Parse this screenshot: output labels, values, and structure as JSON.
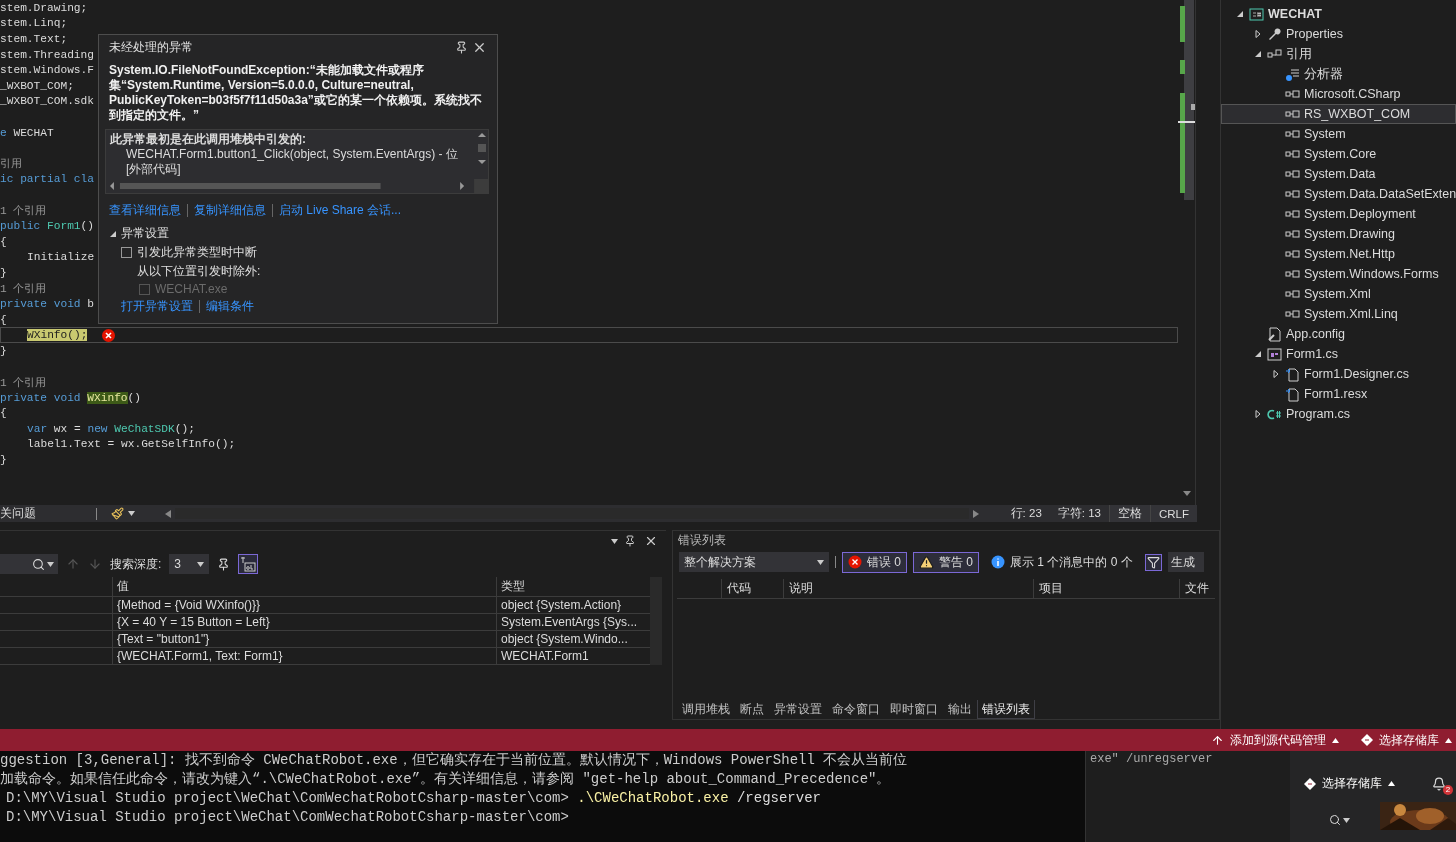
{
  "editor": {
    "code_lines": [
      {
        "kind": "code",
        "tokens": [
          {
            "text": "stem.Drawing;",
            "kind": "plain"
          }
        ]
      },
      {
        "kind": "code",
        "tokens": [
          {
            "text": "stem.Linq;",
            "kind": "plain"
          }
        ]
      },
      {
        "kind": "code",
        "tokens": [
          {
            "text": "stem.Text;",
            "kind": "plain"
          }
        ]
      },
      {
        "kind": "code",
        "tokens": [
          {
            "text": "stem.Threading",
            "kind": "plain"
          }
        ]
      },
      {
        "kind": "code",
        "tokens": [
          {
            "text": "stem.Windows.F",
            "kind": "plain"
          }
        ]
      },
      {
        "kind": "code",
        "tokens": [
          {
            "text": "_WXBOT_COM;",
            "kind": "plain"
          }
        ]
      },
      {
        "kind": "code",
        "tokens": [
          {
            "text": "_WXBOT_COM.sdk",
            "kind": "plain"
          }
        ]
      },
      {
        "kind": "blank"
      },
      {
        "kind": "code",
        "tokens": [
          {
            "text": "e",
            "kind": "keyword"
          },
          {
            "text": " WECHAT",
            "kind": "plain"
          }
        ]
      },
      {
        "kind": "blank"
      },
      {
        "kind": "lens",
        "text": "引用"
      },
      {
        "kind": "code",
        "tokens": [
          {
            "text": "ic partial cla",
            "kind": "keyword"
          }
        ]
      },
      {
        "kind": "blank"
      },
      {
        "kind": "lens",
        "text": "1 个引用"
      },
      {
        "kind": "code",
        "tokens": [
          {
            "text": "public ",
            "kind": "keyword"
          },
          {
            "text": "Form1",
            "kind": "type"
          },
          {
            "text": "()",
            "kind": "plain"
          }
        ]
      },
      {
        "kind": "code",
        "tokens": [
          {
            "text": "{",
            "kind": "plain"
          }
        ]
      },
      {
        "kind": "code",
        "indented": true,
        "tokens": [
          {
            "text": "Initialize",
            "kind": "plain"
          }
        ]
      },
      {
        "kind": "code",
        "tokens": [
          {
            "text": "}",
            "kind": "plain"
          }
        ]
      },
      {
        "kind": "lens",
        "text": "1 个引用"
      },
      {
        "kind": "code",
        "tokens": [
          {
            "text": "private void ",
            "kind": "keyword"
          },
          {
            "text": "b",
            "kind": "plain"
          }
        ]
      },
      {
        "kind": "code",
        "tokens": [
          {
            "text": "{",
            "kind": "plain"
          }
        ]
      },
      {
        "kind": "code",
        "indented": true,
        "current": true,
        "exception": true,
        "tokens": [
          {
            "text": "WXinfo();",
            "kind": "execution"
          }
        ]
      },
      {
        "kind": "code",
        "tokens": [
          {
            "text": "}",
            "kind": "plain"
          }
        ]
      },
      {
        "kind": "blank"
      },
      {
        "kind": "lens",
        "text": "1 个引用"
      },
      {
        "kind": "code",
        "tokens": [
          {
            "text": "private void ",
            "kind": "keyword"
          },
          {
            "text": "WXinfo",
            "kind": "reference"
          },
          {
            "text": "()",
            "kind": "plain"
          }
        ]
      },
      {
        "kind": "code",
        "tokens": [
          {
            "text": "{",
            "kind": "plain"
          }
        ]
      },
      {
        "kind": "code",
        "indented": true,
        "tokens": [
          {
            "text": "var ",
            "kind": "keyword"
          },
          {
            "text": "wx = ",
            "kind": "plain"
          },
          {
            "text": "new ",
            "kind": "keyword"
          },
          {
            "text": "WeChatSDK",
            "kind": "type"
          },
          {
            "text": "();",
            "kind": "plain"
          }
        ]
      },
      {
        "kind": "code",
        "indented": true,
        "tokens": [
          {
            "text": "label1.Text = wx.GetSelfInfo();",
            "kind": "plain"
          }
        ]
      },
      {
        "kind": "code",
        "tokens": [
          {
            "text": "}",
            "kind": "plain"
          }
        ]
      }
    ],
    "status": {
      "issues": "关问题",
      "line": "行: 23",
      "char": "字符: 13",
      "indent": "空格",
      "eol": "CRLF"
    }
  },
  "exception_popup": {
    "title": "未经处理的异常",
    "message": "System.IO.FileNotFoundException:“未能加载文件或程序集“System.Runtime, Version=5.0.0.0, Culture=neutral, PublicKeyToken=b03f5f7f11d50a3a”或它的某一个依赖项。系统找不到指定的文件。”",
    "stack_heading": "此异常最初是在此调用堆栈中引发的:",
    "stack_lines": [
      "WECHAT.Form1.button1_Click(object, System.EventArgs) - 位",
      "[外部代码]"
    ],
    "links": [
      "查看详细信息",
      "复制详细信息",
      "启动 Live Share 会话..."
    ],
    "settings": {
      "title": "异常设置",
      "expanded": true,
      "break_option": {
        "label": "引发此异常类型时中断",
        "checked": false,
        "disabled": false
      },
      "except_label": "从以下位置引发时除外:",
      "except_option": {
        "label": "WECHAT.exe",
        "checked": false,
        "disabled": true
      },
      "links": [
        "打开异常设置",
        "编辑条件"
      ]
    }
  },
  "locals_panel": {
    "search_depth_label": "搜索深度:",
    "search_depth": "3",
    "string_view_selected": true,
    "columns": [
      "值",
      "类型"
    ],
    "rows": [
      {
        "value": "{Method = {Void WXinfo()}}",
        "type": "object {System.Action}"
      },
      {
        "value": "{X = 40 Y = 15 Button = Left}",
        "type": "System.EventArgs {Sys..."
      },
      {
        "value": "{Text = \"button1\"}",
        "type": "object {System.Windo..."
      },
      {
        "value": "{WECHAT.Form1, Text: Form1}",
        "type": "WECHAT.Form1"
      }
    ]
  },
  "error_list": {
    "title": "错误列表",
    "scope": "整个解决方案",
    "filters": [
      {
        "kind": "error",
        "label": "错误 0",
        "selected": true
      },
      {
        "kind": "warning",
        "label": "警告 0",
        "selected": true
      },
      {
        "kind": "message",
        "label": "展示 1 个消息中的 0 个",
        "selected": false
      }
    ],
    "filter_toggle_selected": true,
    "build_source": "生成",
    "columns": [
      "代码",
      "说明",
      "项目",
      "文件"
    ]
  },
  "tool_tabs": [
    {
      "label": "调用堆栈",
      "selected": false
    },
    {
      "label": "断点",
      "selected": false
    },
    {
      "label": "异常设置",
      "selected": false
    },
    {
      "label": "命令窗口",
      "selected": false
    },
    {
      "label": "即时窗口",
      "selected": false
    },
    {
      "label": "输出",
      "selected": false
    },
    {
      "label": "错误列表",
      "selected": true
    }
  ],
  "solution_explorer": {
    "tree": [
      {
        "label": "WECHAT",
        "kind": "project",
        "bold": true,
        "expanded": true,
        "selected": false,
        "children": [
          {
            "label": "Properties",
            "kind": "properties",
            "expanded": false,
            "selected": false
          },
          {
            "label": "引用",
            "kind": "references",
            "expanded": true,
            "selected": false,
            "children": [
              {
                "label": "分析器",
                "kind": "analyzers",
                "selected": false
              },
              {
                "label": "Microsoft.CSharp",
                "kind": "assembly",
                "selected": false
              },
              {
                "label": "RS_WXBOT_COM",
                "kind": "assembly",
                "selected": true
              },
              {
                "label": "System",
                "kind": "assembly",
                "selected": false
              },
              {
                "label": "System.Core",
                "kind": "assembly",
                "selected": false
              },
              {
                "label": "System.Data",
                "kind": "assembly",
                "selected": false
              },
              {
                "label": "System.Data.DataSetExten",
                "kind": "assembly",
                "selected": false
              },
              {
                "label": "System.Deployment",
                "kind": "assembly",
                "selected": false
              },
              {
                "label": "System.Drawing",
                "kind": "assembly",
                "selected": false
              },
              {
                "label": "System.Net.Http",
                "kind": "assembly",
                "selected": false
              },
              {
                "label": "System.Windows.Forms",
                "kind": "assembly",
                "selected": false
              },
              {
                "label": "System.Xml",
                "kind": "assembly",
                "selected": false
              },
              {
                "label": "System.Xml.Linq",
                "kind": "assembly",
                "selected": false
              }
            ]
          },
          {
            "label": "App.config",
            "kind": "config",
            "selected": false
          },
          {
            "label": "Form1.cs",
            "kind": "form",
            "expanded": true,
            "selected": false,
            "children": [
              {
                "label": "Form1.Designer.cs",
                "kind": "file",
                "expanded": false,
                "selected": false
              },
              {
                "label": "Form1.resx",
                "kind": "file",
                "selected": false
              }
            ]
          },
          {
            "label": "Program.cs",
            "kind": "csharp",
            "expanded": false,
            "selected": false
          }
        ]
      }
    ]
  },
  "status_bar": {
    "items": [
      {
        "kind": "source-control",
        "label": "添加到源代码管理"
      },
      {
        "kind": "repository",
        "label": "选择存储库"
      }
    ]
  },
  "terminal": {
    "lines": [
      {
        "kind": "output",
        "text": "ggestion [3,General]: 找不到命令 CWeChatRobot.exe，但它确实存在于当前位置。默认情况下，Windows PowerShell 不会从当前位"
      },
      {
        "kind": "output",
        "text": "加载命令。如果信任此命令，请改为键入“.\\CWeChatRobot.exe”。有关详细信息，请参阅 \"get-help about_Command_Precedence\"。"
      },
      {
        "kind": "prompt",
        "path": "D:\\MY\\Visual Studio project\\WeChat\\ComWechatRobotCsharp-master\\com>",
        "command": ".\\CWeChatRobot.exe",
        "args": "/regserver"
      },
      {
        "kind": "prompt",
        "path": "D:\\MY\\Visual Studio project\\WeChat\\ComWechatRobotCsharp-master\\com>"
      }
    ]
  },
  "side_terminal_text": "exe\" /unregserver",
  "git_panel": {
    "repository": "选择存储库",
    "notifications": "2"
  }
}
